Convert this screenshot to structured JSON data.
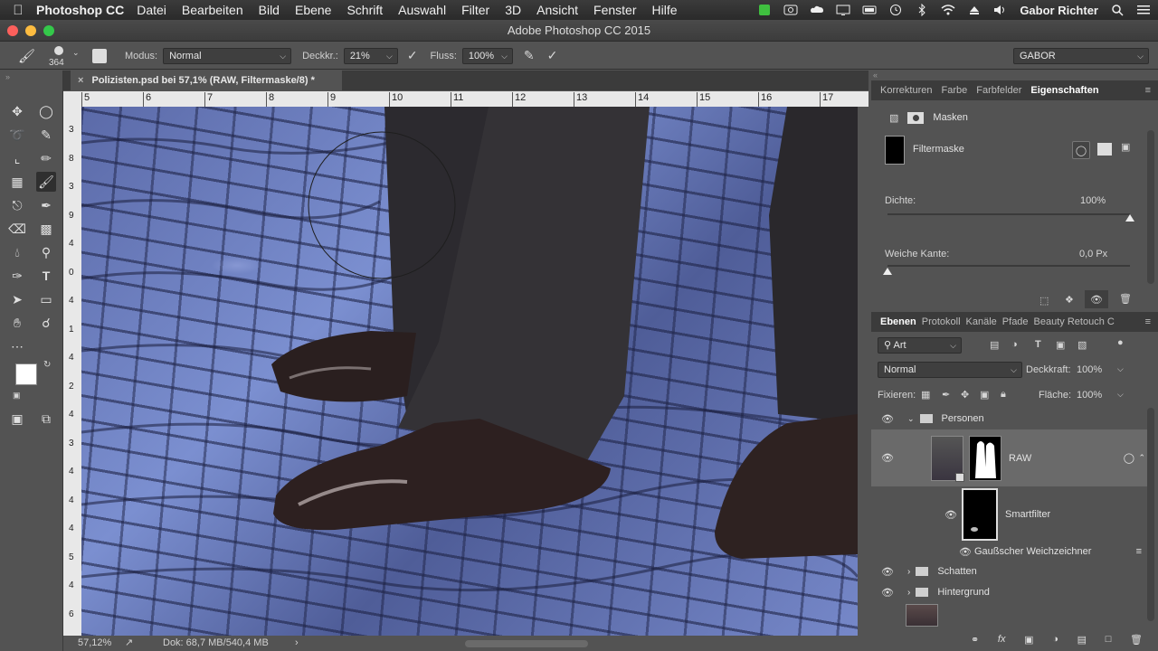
{
  "menubar": {
    "app_name": "Photoshop CC",
    "items": [
      "Datei",
      "Bearbeiten",
      "Bild",
      "Ebene",
      "Schrift",
      "Auswahl",
      "Filter",
      "3D",
      "Ansicht",
      "Fenster",
      "Hilfe"
    ],
    "user": "Gabor Richter"
  },
  "window": {
    "title": "Adobe Photoshop CC 2015"
  },
  "options": {
    "brush_size": "364",
    "mode_label": "Modus:",
    "mode_value": "Normal",
    "opacity_label": "Deckkr.:",
    "opacity_value": "21%",
    "flow_label": "Fluss:",
    "flow_value": "100%",
    "workspace": "GABOR"
  },
  "document": {
    "tab_title": "Polizisten.psd bei 57,1% (RAW, Filtermaske/8) *",
    "ruler_top": [
      "5",
      "6",
      "7",
      "8",
      "9",
      "10",
      "11",
      "12",
      "13",
      "14",
      "15",
      "16",
      "17"
    ],
    "ruler_left": [
      "3",
      "8",
      "3",
      "9",
      "4",
      "0",
      "4",
      "1",
      "4",
      "2",
      "4",
      "3",
      "4",
      "4",
      "4",
      "5",
      "4",
      "6"
    ]
  },
  "status": {
    "zoom": "57,12%",
    "doc_size": "Dok: 68,7 MB/540,4 MB"
  },
  "properties_panel": {
    "tabs": [
      "Korrekturen",
      "Farbe",
      "Farbfelder",
      "Eigenschaften"
    ],
    "active_tab": "Eigenschaften",
    "section_title": "Masken",
    "mask_name": "Filtermaske",
    "density_label": "Dichte:",
    "density_value": "100%",
    "density_level": 1.0,
    "feather_label": "Weiche Kante:",
    "feather_value": "0,0 Px",
    "feather_level": 0.0
  },
  "layers_panel": {
    "tabs": [
      "Ebenen",
      "Protokoll",
      "Kanäle",
      "Pfade",
      "Beauty Retouch C"
    ],
    "active_tab": "Ebenen",
    "filter_kind": "Art",
    "blend_mode": "Normal",
    "opacity_label": "Deckkraft:",
    "opacity_value": "100%",
    "lock_label": "Fixieren:",
    "fill_label": "Fläche:",
    "fill_value": "100%",
    "layers": {
      "group_personen": "Personen",
      "raw": "RAW",
      "smartfilter": "Smartfilter",
      "gauss": "Gaußscher Weichzeichner",
      "group_schatten": "Schatten",
      "group_hintergrund": "Hintergrund"
    }
  },
  "colors": {
    "ui_bg": "#535353",
    "panel_dark": "#3b3b3b",
    "foreground_swatch": "#ffffff",
    "background_swatch": "#000000",
    "selected_layer": "#6a6a6a"
  }
}
